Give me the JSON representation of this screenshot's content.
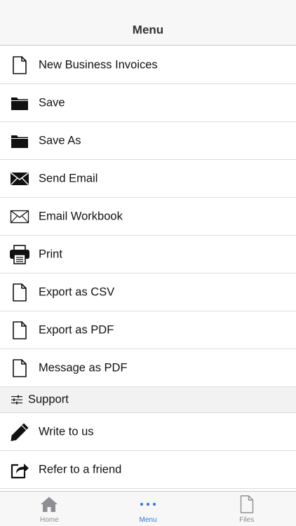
{
  "header": {
    "title": "Menu"
  },
  "menu": {
    "items": [
      {
        "label": "New Business Invoices",
        "icon": "document-icon"
      },
      {
        "label": "Save",
        "icon": "folder-icon"
      },
      {
        "label": "Save As",
        "icon": "folder-icon"
      },
      {
        "label": "Send Email",
        "icon": "envelope-filled-icon"
      },
      {
        "label": "Email Workbook",
        "icon": "envelope-outline-icon"
      },
      {
        "label": "Print",
        "icon": "printer-icon"
      },
      {
        "label": "Export as CSV",
        "icon": "document-icon"
      },
      {
        "label": "Export as PDF",
        "icon": "document-icon"
      },
      {
        "label": "Message as PDF",
        "icon": "document-icon"
      }
    ]
  },
  "support": {
    "header": "Support",
    "icon": "sliders-icon",
    "items": [
      {
        "label": "Write to us",
        "icon": "pencil-icon"
      },
      {
        "label": "Refer to a friend",
        "icon": "share-icon"
      }
    ]
  },
  "tabbar": {
    "tabs": [
      {
        "label": "Home",
        "icon": "home-icon",
        "active": false
      },
      {
        "label": "Menu",
        "icon": "more-dots-icon",
        "active": true
      },
      {
        "label": "Files",
        "icon": "file-icon",
        "active": false
      }
    ]
  },
  "colors": {
    "accent": "#2f7de1",
    "inactive_tab": "#8e8e93",
    "nav_background": "#f7f7f7",
    "section_background": "#f2f2f2",
    "separator": "#dcdcdc"
  }
}
